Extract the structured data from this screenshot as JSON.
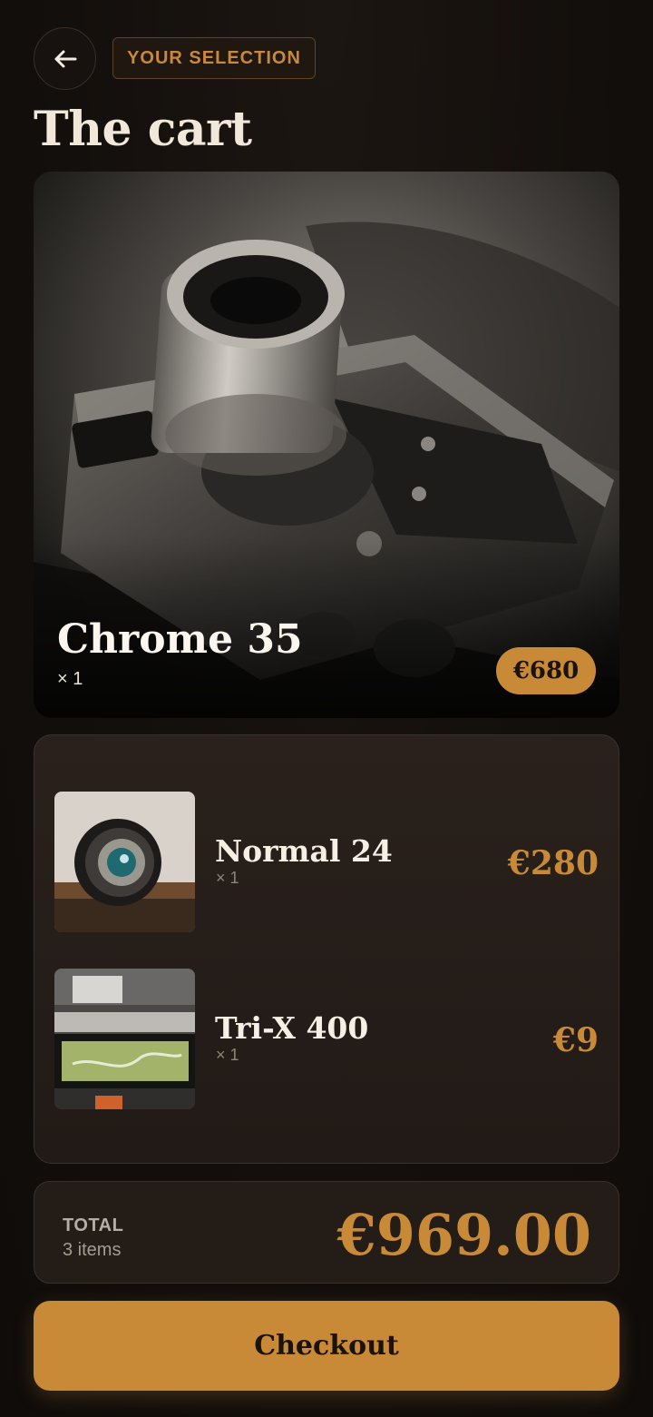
{
  "header": {
    "eyebrow": "YOUR SELECTION",
    "title": "The cart"
  },
  "hero_item": {
    "name": "Chrome 35",
    "qty": "× 1",
    "price": "€680"
  },
  "items": [
    {
      "name": "Normal 24",
      "qty": "× 1",
      "price": "€280"
    },
    {
      "name": "Tri-X 400",
      "qty": "× 1",
      "price": "€9"
    }
  ],
  "total": {
    "label": "TOTAL",
    "count": "3 items",
    "amount": "€969.00"
  },
  "checkout_label": "Checkout",
  "colors": {
    "accent": "#c98a37",
    "background": "#130f0c",
    "card": "#231c17"
  }
}
